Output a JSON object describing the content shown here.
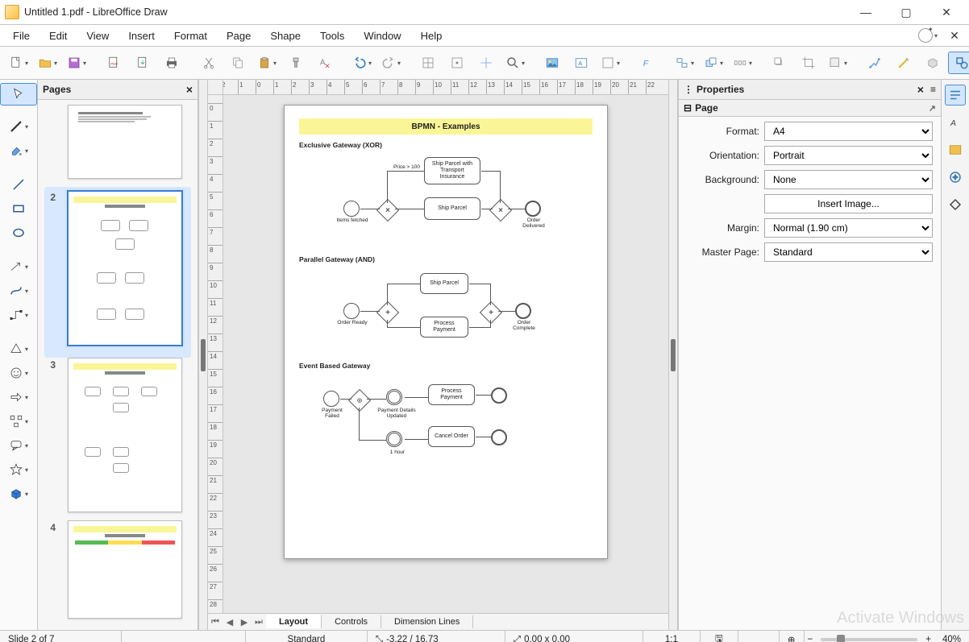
{
  "window": {
    "title": "Untitled 1.pdf - LibreOffice Draw"
  },
  "menubar": [
    "File",
    "Edit",
    "View",
    "Insert",
    "Format",
    "Page",
    "Shape",
    "Tools",
    "Window",
    "Help"
  ],
  "pages_panel": {
    "title": "Pages",
    "visible_thumbs": [
      2,
      3,
      4
    ],
    "selected": 2
  },
  "canvas": {
    "doc_title": "BPMN - Examples",
    "sections": {
      "xor": {
        "heading": "Exclusive Gateway (XOR)",
        "condition_label": "Price > 100",
        "task_insured": "Ship Parcel with Transport Insurance",
        "task_ship": "Ship Parcel",
        "start_label": "Items fetched",
        "end_label": "Order Delivered"
      },
      "and": {
        "heading": "Parallel Gateway (AND)",
        "task_ship": "Ship Parcel",
        "task_pay": "Process Payment",
        "start_label": "Order Ready",
        "end_label": "Order Complete"
      },
      "evt": {
        "heading": "Event Based Gateway",
        "task_process": "Process Payment",
        "task_cancel": "Cancel Order",
        "evt_msg_label": "Payment Details Updated",
        "evt_timer_label": "1 hour",
        "start_label": "Payment Failed"
      }
    },
    "tabs": [
      "Layout",
      "Controls",
      "Dimension Lines"
    ],
    "active_tab": "Layout"
  },
  "properties": {
    "panel_title": "Properties",
    "group_title": "Page",
    "rows": {
      "format_label": "Format:",
      "format_value": "A4",
      "orientation_label": "Orientation:",
      "orientation_value": "Portrait",
      "background_label": "Background:",
      "background_value": "None",
      "insert_image_btn": "Insert Image...",
      "margin_label": "Margin:",
      "margin_value": "Normal (1.90 cm)",
      "master_label": "Master Page:",
      "master_value": "Standard"
    }
  },
  "status": {
    "slide": "Slide 2 of 7",
    "style": "Standard",
    "coords": "-3.22 / 16.73",
    "size": "0.00 x 0.00",
    "scale": "1:1",
    "zoom_pct": "40%"
  },
  "watermark": "Activate Windows"
}
